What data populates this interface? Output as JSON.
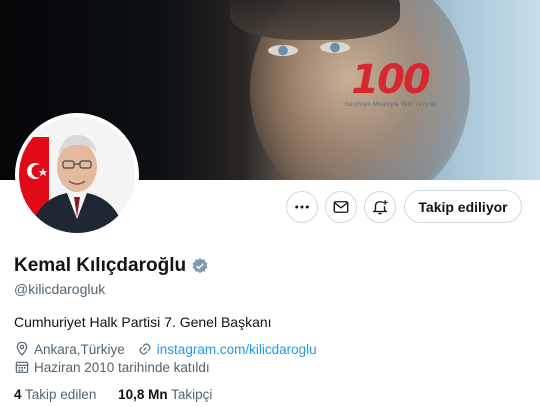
{
  "banner": {
    "brand_number": "100",
    "brand_tagline": "Geçmişin Mirasıyla Yeni Yüzyıla"
  },
  "profile": {
    "name": "Kemal Kılıçdaroğlu",
    "handle": "@kilicdarogluk",
    "bio": "Cumhuriyet Halk Partisi 7. Genel Başkanı",
    "location": "Ankara,Türkiye",
    "website": "instagram.com/kilicdaroglu",
    "joined": "Haziran 2010 tarihinde katıldı",
    "following_count": "4",
    "following_label": "Takip edilen",
    "followers_count": "10,8 Mn",
    "followers_label": "Takipçi"
  },
  "actions": {
    "follow_label": "Takip ediliyor",
    "more_icon": "more-icon",
    "message_icon": "message-icon",
    "notify_icon": "bell-plus-icon"
  },
  "colors": {
    "accent": "#1d9bf0",
    "brand_red": "#d7282f",
    "verified": "#829aab"
  }
}
